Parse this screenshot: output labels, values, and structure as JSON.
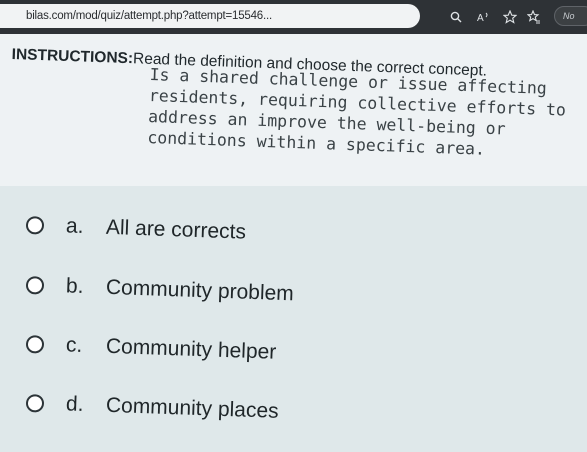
{
  "browser": {
    "url": "bilas.com/mod/quiz/attempt.php?attempt=15546...",
    "profile_label": "No"
  },
  "question": {
    "instructions_label": "INSTRUCTIONS:",
    "instructions_text": "Read the definition and choose the correct concept.",
    "definition": "Is a shared challenge or issue affecting residents, requiring collective efforts to address an improve the well-being or conditions within a specific area."
  },
  "options": [
    {
      "letter": "a.",
      "text": "All are corrects"
    },
    {
      "letter": "b.",
      "text": "Community problem"
    },
    {
      "letter": "c.",
      "text": "Community helper"
    },
    {
      "letter": "d.",
      "text": "Community places"
    }
  ],
  "icons": {
    "address_bar": [
      "search-icon",
      "read-aloud-icon",
      "favorite-star-icon",
      "favorites-icon",
      "extension-icon",
      "browser-essentials-icon"
    ]
  }
}
